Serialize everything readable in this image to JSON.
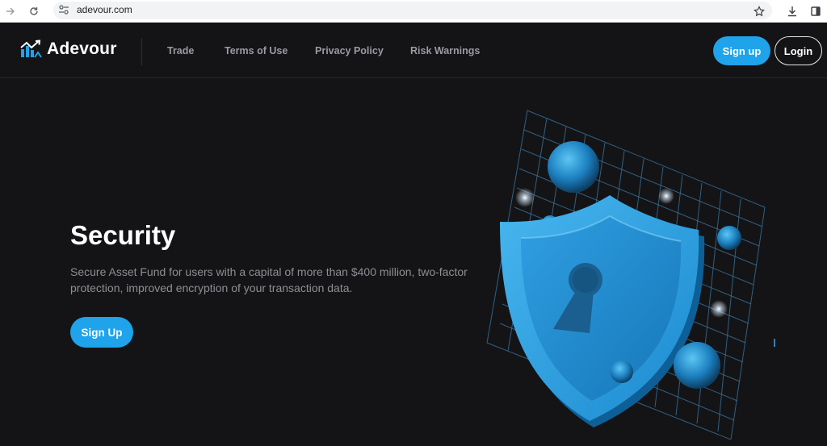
{
  "browser": {
    "url": "adevour.com"
  },
  "header": {
    "brand": "Adevour",
    "nav": [
      "Trade",
      "Terms of Use",
      "Privacy Policy",
      "Risk Warnings"
    ],
    "signup_label": "Sign up",
    "login_label": "Login"
  },
  "hero": {
    "title": "Security",
    "description": "Secure Asset Fund for users with a capital of more than $400 million, two-factor protection, improved encryption of your transaction data.",
    "cta_label": "Sign Up"
  },
  "colors": {
    "accent": "#1fa3ea",
    "background": "#141416"
  },
  "icons": [
    "arrow-forward-icon",
    "reload-icon",
    "site-info-icon",
    "star-icon",
    "download-icon",
    "side-panel-icon",
    "shield-lock-icon"
  ]
}
